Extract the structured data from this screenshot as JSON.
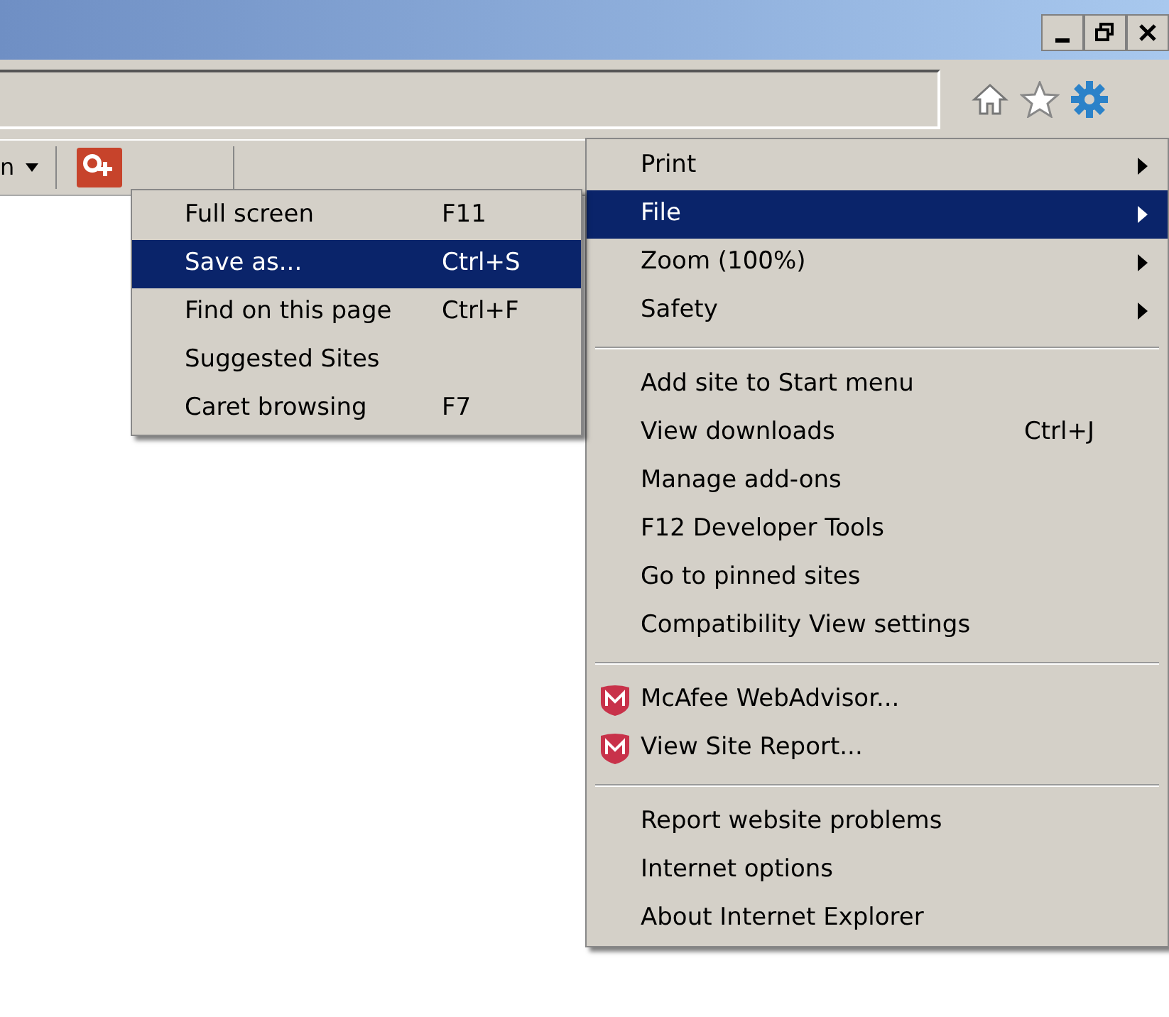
{
  "toolbar": {
    "partial_label": "n"
  },
  "menu": {
    "groups": [
      [
        {
          "label": "Print",
          "submenu": true,
          "selected": false
        },
        {
          "label": "File",
          "submenu": true,
          "selected": true
        },
        {
          "label": "Zoom (100%)",
          "submenu": true,
          "selected": false
        },
        {
          "label": "Safety",
          "submenu": true,
          "selected": false
        }
      ],
      [
        {
          "label": "Add site to Start menu",
          "selected": false
        },
        {
          "label": "View downloads",
          "shortcut": "Ctrl+J",
          "selected": false
        },
        {
          "label": "Manage add-ons",
          "selected": false
        },
        {
          "label": "F12 Developer Tools",
          "selected": false
        },
        {
          "label": "Go to pinned sites",
          "selected": false
        },
        {
          "label": "Compatibility View settings",
          "selected": false
        }
      ],
      [
        {
          "label": "McAfee WebAdvisor...",
          "icon": true,
          "selected": false
        },
        {
          "label": "View Site Report...",
          "icon": true,
          "selected": false
        }
      ],
      [
        {
          "label": "Report website problems",
          "selected": false
        },
        {
          "label": "Internet options",
          "selected": false
        },
        {
          "label": "About Internet Explorer",
          "selected": false
        }
      ]
    ]
  },
  "file_submenu": {
    "items": [
      {
        "label": "Full screen",
        "shortcut": "F11",
        "selected": false
      },
      {
        "label": "Save as...",
        "shortcut": "Ctrl+S",
        "selected": true
      },
      {
        "label": "Find on this page",
        "shortcut": "Ctrl+F",
        "selected": false
      },
      {
        "label": "Suggested Sites",
        "selected": false
      },
      {
        "label": "Caret browsing",
        "shortcut": "F7",
        "selected": false
      }
    ]
  }
}
